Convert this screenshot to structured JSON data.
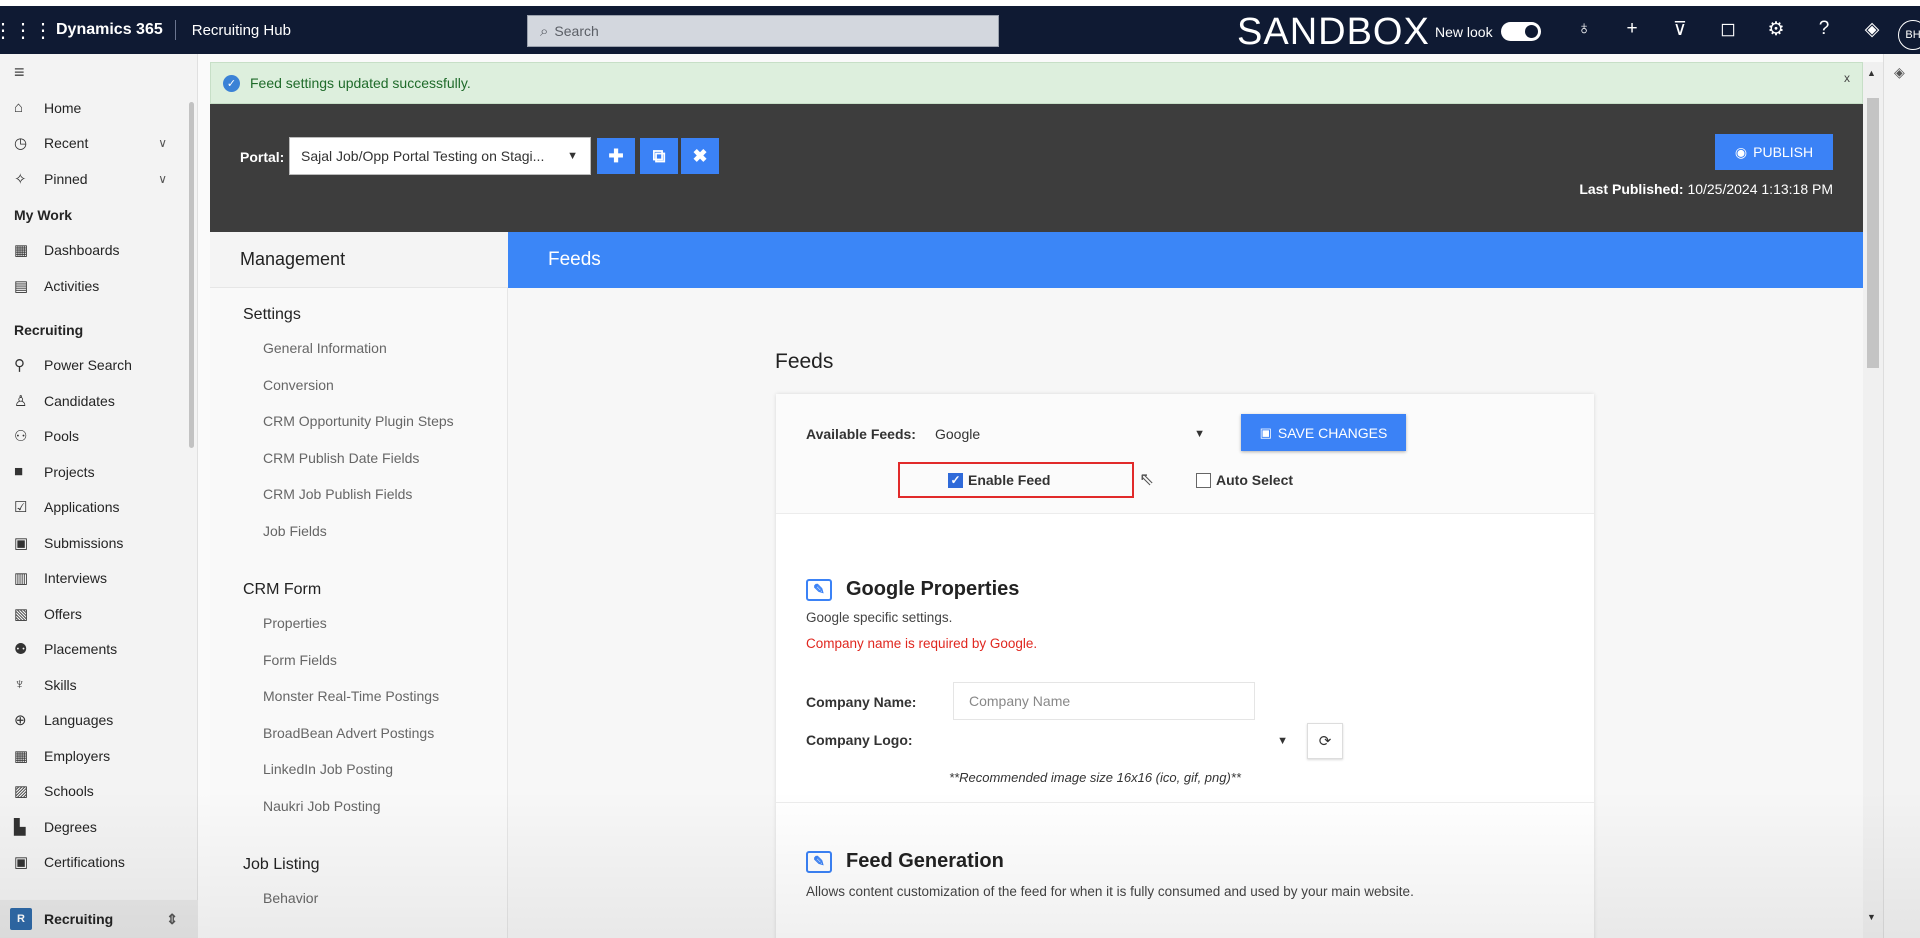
{
  "topbar": {
    "app_name": "Dynamics 365",
    "hub_name": "Recruiting Hub",
    "search_placeholder": "Search",
    "environment": "SANDBOX",
    "new_look_label": "New look",
    "avatar_initials": "BH"
  },
  "leftnav": {
    "items_top": [
      {
        "label": "Home",
        "icon": "home-icon"
      },
      {
        "label": "Recent",
        "icon": "clock-icon"
      },
      {
        "label": "Pinned",
        "icon": "pin-icon"
      }
    ],
    "my_work_label": "My Work",
    "my_work_items": [
      {
        "label": "Dashboards"
      },
      {
        "label": "Activities"
      }
    ],
    "recruiting_label": "Recruiting",
    "recruiting_items": [
      {
        "label": "Power Search"
      },
      {
        "label": "Candidates"
      },
      {
        "label": "Pools"
      },
      {
        "label": "Projects"
      },
      {
        "label": "Applications"
      },
      {
        "label": "Submissions"
      },
      {
        "label": "Interviews"
      },
      {
        "label": "Offers"
      },
      {
        "label": "Placements"
      },
      {
        "label": "Skills"
      },
      {
        "label": "Languages"
      },
      {
        "label": "Employers"
      },
      {
        "label": "Schools"
      },
      {
        "label": "Degrees"
      },
      {
        "label": "Certifications"
      }
    ],
    "area_badge": "R",
    "area_label": "Recruiting"
  },
  "notice": {
    "message": "Feed settings updated successfully.",
    "close": "x"
  },
  "portal": {
    "label": "Portal:",
    "selected": "Sajal Job/Opp Portal Testing on Stagi...",
    "publish_label": "PUBLISH",
    "last_published_label": "Last Published:",
    "last_published_value": "10/25/2024 1:13:18 PM"
  },
  "management": {
    "title": "Management",
    "sections": [
      {
        "title": "Settings",
        "items": [
          "General Information",
          "Conversion",
          "CRM Opportunity Plugin Steps",
          "CRM Publish Date Fields",
          "CRM Job Publish Fields",
          "Job Fields"
        ]
      },
      {
        "title": "CRM Form",
        "items": [
          "Properties",
          "Form Fields",
          "Monster Real-Time Postings",
          "BroadBean Advert Postings",
          "LinkedIn Job Posting",
          "Naukri Job Posting"
        ]
      },
      {
        "title": "Job Listing",
        "items": [
          "Behavior"
        ]
      }
    ]
  },
  "feeds": {
    "header": "Feeds",
    "title": "Feeds",
    "available_label": "Available Feeds:",
    "available_value": "Google",
    "save_label": "SAVE CHANGES",
    "enable_feed_label": "Enable Feed",
    "enable_feed_checked": true,
    "auto_select_label": "Auto Select",
    "auto_select_checked": false,
    "google": {
      "title": "Google Properties",
      "desc": "Google specific settings.",
      "error": "Company name is required by Google.",
      "company_name_label": "Company Name:",
      "company_name_placeholder": "Company Name",
      "company_logo_label": "Company Logo:",
      "note": "**Recommended image size 16x16 (ico, gif, png)**"
    },
    "generation": {
      "title": "Feed Generation",
      "desc": "Allows content customization of the feed for when it is fully consumed and used by your main website."
    }
  }
}
